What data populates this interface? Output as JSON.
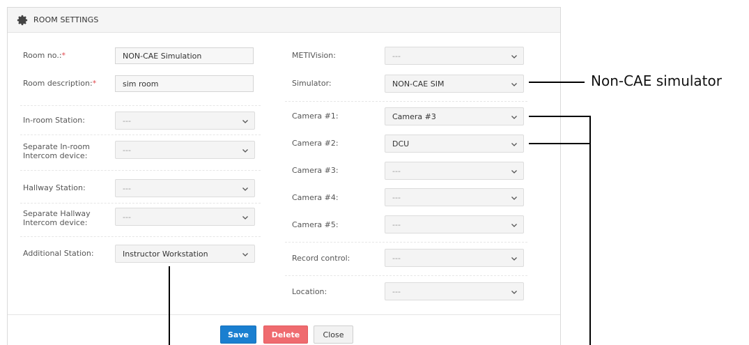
{
  "dialog": {
    "title": "ROOM SETTINGS",
    "icon": "gear-icon"
  },
  "left": {
    "room_no": {
      "label": "Room no.:",
      "required": "*",
      "value": "NON-CAE Simulation"
    },
    "room_description": {
      "label": "Room description:",
      "required": "*",
      "value": "sim room"
    },
    "in_room_station": {
      "label": "In-room Station:",
      "value": "---"
    },
    "separate_in_room_intercom": {
      "label_line1": "Separate In-room",
      "label_line2": "Intercom device:",
      "value": "---"
    },
    "hallway_station": {
      "label": "Hallway Station:",
      "value": "---"
    },
    "separate_hallway_intercom": {
      "label_line1": "Separate Hallway",
      "label_line2": "Intercom device:",
      "value": "---"
    },
    "additional_station": {
      "label": "Additional Station:",
      "value": "Instructor Workstation"
    }
  },
  "right": {
    "metivision": {
      "label": "METIVision:",
      "value": "---"
    },
    "simulator": {
      "label": "Simulator:",
      "value": "NON-CAE SIM"
    },
    "camera1": {
      "label": "Camera #1:",
      "value": "Camera #3"
    },
    "camera2": {
      "label": "Camera #2:",
      "value": "DCU"
    },
    "camera3": {
      "label": "Camera #3:",
      "value": "---"
    },
    "camera4": {
      "label": "Camera #4:",
      "value": "---"
    },
    "camera5": {
      "label": "Camera #5:",
      "value": "---"
    },
    "record_control": {
      "label": "Record control:",
      "value": "---"
    },
    "location": {
      "label": "Location:",
      "value": "---"
    }
  },
  "footer": {
    "save": "Save",
    "delete": "Delete",
    "close": "Close"
  },
  "annotation": {
    "simulator_callout": "Non-CAE simulator"
  }
}
